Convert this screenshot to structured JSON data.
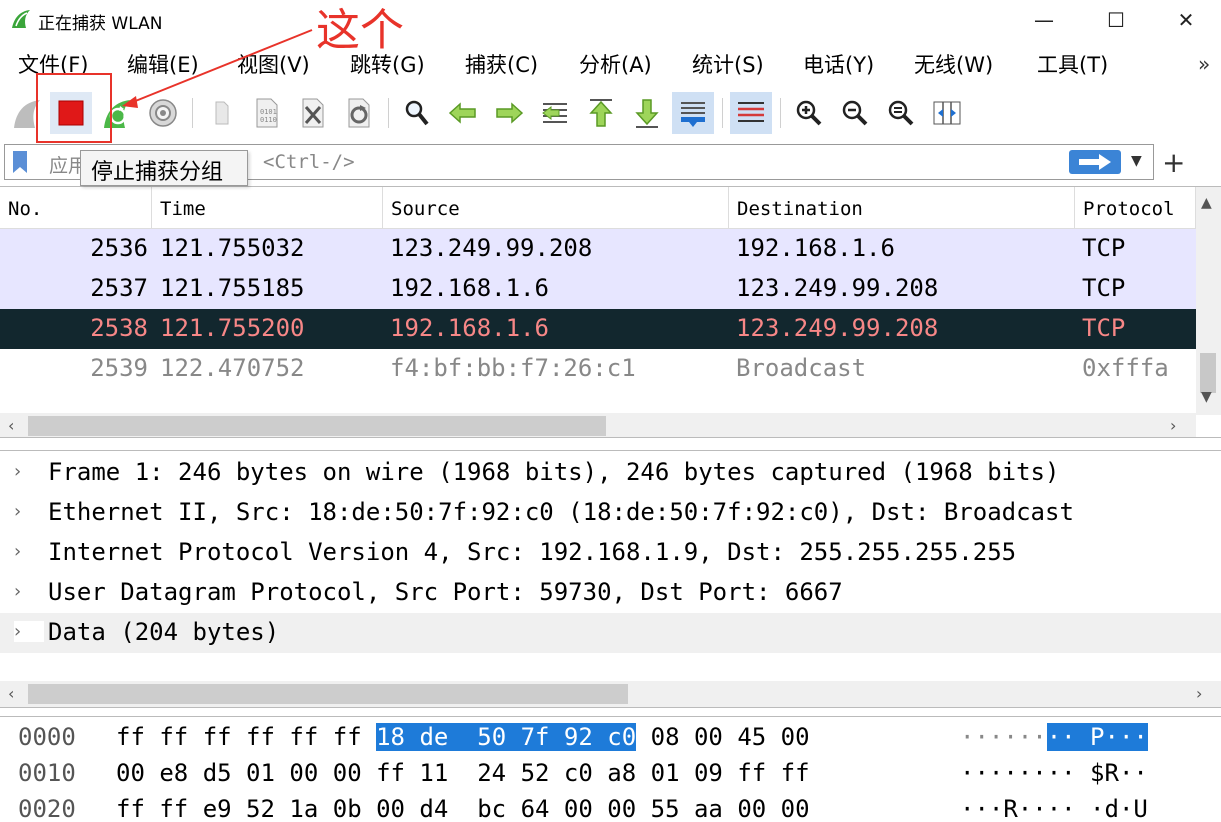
{
  "window": {
    "title": "正在捕获 WLAN",
    "minimize": "—",
    "maximize": "☐",
    "close": "✕"
  },
  "menu": {
    "items": [
      {
        "label": "文件(F)"
      },
      {
        "label": "编辑(E)"
      },
      {
        "label": "视图(V)"
      },
      {
        "label": "跳转(G)"
      },
      {
        "label": "捕获(C)"
      },
      {
        "label": "分析(A)"
      },
      {
        "label": "统计(S)"
      },
      {
        "label": "电话(Y)"
      },
      {
        "label": "无线(W)"
      },
      {
        "label": "工具(T)"
      }
    ],
    "more": "»"
  },
  "annotation": {
    "text": "这个"
  },
  "tooltip": "停止捕获分组",
  "filter": {
    "placeholder": "应用",
    "shortcut": "<Ctrl-/>",
    "add": "+"
  },
  "packet_list": {
    "columns": [
      "No.",
      "Time",
      "Source",
      "Destination",
      "Protocol"
    ],
    "rows": [
      {
        "no": "2536",
        "time": "121.755032",
        "src": "123.249.99.208",
        "dst": "192.168.1.6",
        "proto": "TCP",
        "style": "tcp"
      },
      {
        "no": "2537",
        "time": "121.755185",
        "src": "192.168.1.6",
        "dst": "123.249.99.208",
        "proto": "TCP",
        "style": "tcp"
      },
      {
        "no": "2538",
        "time": "121.755200",
        "src": "192.168.1.6",
        "dst": "123.249.99.208",
        "proto": "TCP",
        "style": "selected"
      },
      {
        "no": "2539",
        "time": "122.470752",
        "src": "f4:bf:bb:f7:26:c1",
        "dst": "Broadcast",
        "proto": "0xfffa",
        "style": "other"
      }
    ]
  },
  "details": {
    "rows": [
      "Frame 1: 246 bytes on wire (1968 bits), 246 bytes captured (1968 bits)",
      "Ethernet II, Src: 18:de:50:7f:92:c0 (18:de:50:7f:92:c0), Dst: Broadcast",
      "Internet Protocol Version 4, Src: 192.168.1.9, Dst: 255.255.255.255",
      "User Datagram Protocol, Src Port: 59730, Dst Port: 6667",
      "Data (204 bytes)"
    ]
  },
  "bytes": {
    "rows": [
      {
        "offset": "0000",
        "hex_pre": "ff ff ff ff ff ff ",
        "hex_sel": "18 de  50 7f 92 c0",
        "hex_post": " 08 00 45 00",
        "asc_pre": "······",
        "asc_sel": "·· P···",
        "asc_post": ""
      },
      {
        "offset": "0010",
        "hex_pre": "00 e8 d5 01 00 00 ff 11  24 52 c0 a8 01 09 ff ff",
        "hex_sel": "",
        "hex_post": "",
        "asc_pre": "········ $R··",
        "asc_sel": "",
        "asc_post": ""
      },
      {
        "offset": "0020",
        "hex_pre": "ff ff e9 52 1a 0b 00 d4  bc 64 00 00 55 aa 00 00",
        "hex_sel": "",
        "hex_post": "",
        "asc_pre": "···R···· ·d·U",
        "asc_sel": "",
        "asc_post": ""
      }
    ]
  },
  "colors": {
    "tcp_row_bg": "#e7e6ff",
    "selected_bg": "#12272e",
    "selected_fg": "#f78787",
    "accent_red": "#e8332a",
    "selection_blue": "#1e7bd9"
  }
}
